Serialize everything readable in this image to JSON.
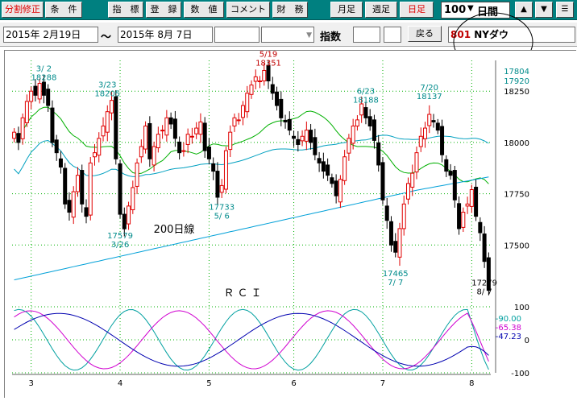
{
  "toolbar": {
    "buttons": [
      {
        "label": "分割修正",
        "color": "red"
      },
      {
        "label": "条　件"
      },
      {
        "label": "指　標"
      },
      {
        "label": "登　録"
      },
      {
        "label": "数　値"
      },
      {
        "label": "コメント"
      },
      {
        "label": "財　務"
      },
      {
        "label": "月足"
      },
      {
        "label": "週足"
      },
      {
        "label": "日足",
        "color": "red"
      }
    ],
    "period_value": "100",
    "period_unit": "日間",
    "up_icon": "triangle-up-icon",
    "down_icon": "triangle-down-icon",
    "menu_icon": "menu-icon"
  },
  "dates": {
    "start": "2015年 2月19日",
    "separator": "〜",
    "end": "2015年 8月 7日"
  },
  "index_label": "指数",
  "back_button": "戻る",
  "symbol": {
    "code": "801",
    "name": "NYダウ"
  },
  "colors": {
    "up_candle": "#e00000",
    "down_candle": "#000000",
    "ma_short": "#00b000",
    "ma_mid": "#00a0c0",
    "ma200": "#00a0d8",
    "rci_short": "#00a0a0",
    "rci_mid": "#d000d0",
    "rci_long": "#0000b0",
    "annotation_blue": "#008b8b",
    "annotation_red": "#c00000",
    "grid": "#00b000"
  },
  "chart_data": [
    {
      "type": "candlestick",
      "x_axis": "date (trading days)",
      "ylim": [
        17250,
        18400
      ],
      "price_ticks": [
        18250,
        18000,
        17750,
        17500
      ],
      "month_labels": [
        {
          "label": "3",
          "day": 4
        },
        {
          "label": "4",
          "day": 25
        },
        {
          "label": "5",
          "day": 46
        },
        {
          "label": "6",
          "day": 66
        },
        {
          "label": "7",
          "day": 87
        },
        {
          "label": "8",
          "day": 108
        }
      ],
      "ma_labels": {
        "top": "17804",
        "second": "17920"
      },
      "annotations": [
        {
          "text": [
            "3/ 2",
            "18288"
          ],
          "day": 7,
          "where": "above",
          "color": "blue"
        },
        {
          "text": [
            "3/23",
            "18205"
          ],
          "day": 22,
          "where": "above",
          "color": "blue"
        },
        {
          "text": [
            "17579",
            "3/26"
          ],
          "day": 25,
          "where": "below",
          "color": "blue"
        },
        {
          "text": [
            "5/19",
            "18351"
          ],
          "day": 60,
          "where": "above",
          "color": "red"
        },
        {
          "text": [
            "17733",
            "5/ 6"
          ],
          "day": 49,
          "where": "below",
          "color": "blue"
        },
        {
          "text": [
            "6/23",
            "18188"
          ],
          "day": 83,
          "where": "above",
          "color": "blue"
        },
        {
          "text": [
            "7/20",
            "18137"
          ],
          "day": 98,
          "where": "above",
          "color": "blue"
        },
        {
          "text": [
            "17465",
            "7/ 7"
          ],
          "day": 90,
          "where": "below",
          "color": "blue"
        },
        {
          "text": [
            "17279",
            "8/ 7"
          ],
          "day": 111,
          "where": "below",
          "color": "black"
        }
      ],
      "ma200_label": "200日線",
      "closes": [
        18050,
        18000,
        18120,
        18200,
        18250,
        18230,
        18288,
        18230,
        18180,
        18000,
        17950,
        17880,
        17700,
        17660,
        17760,
        17840,
        17700,
        17640,
        17900,
        17950,
        18020,
        18080,
        18150,
        18205,
        17920,
        17650,
        17579,
        17690,
        17780,
        17900,
        17980,
        18080,
        17920,
        17980,
        18040,
        18060,
        18120,
        18090,
        18020,
        17950,
        17960,
        18040,
        18030,
        18070,
        18100,
        17960,
        17920,
        17860,
        17733,
        17790,
        17960,
        18050,
        18120,
        18110,
        18180,
        18240,
        18280,
        18320,
        18300,
        18351,
        18300,
        18240,
        18180,
        18120,
        18100,
        18060,
        18020,
        17990,
        18030,
        18060,
        18000,
        17940,
        17900,
        17860,
        17840,
        17800,
        17740,
        17820,
        17930,
        18020,
        18080,
        18110,
        18188,
        18120,
        18080,
        18010,
        17890,
        17720,
        17620,
        17500,
        17465,
        17580,
        17700,
        17800,
        17850,
        17950,
        18030,
        18070,
        18137,
        18100,
        18060,
        17940,
        17860,
        17840,
        17720,
        17580,
        17660,
        17700,
        17770,
        17640,
        17560,
        17420,
        17279
      ],
      "ma_short": {
        "start": 17700,
        "end": 17750
      },
      "series_rci": [
        {
          "name": "-90.00",
          "final": -90.0,
          "color": "cyan"
        },
        {
          "name": "-65.38",
          "final": -65.38,
          "color": "magenta"
        },
        {
          "name": "-47.23",
          "final": -47.23,
          "color": "navy"
        }
      ]
    },
    {
      "type": "line",
      "title": "ＲＣＩ",
      "ylim": [
        -100,
        100
      ],
      "y_ticks": [
        100,
        0,
        -100
      ],
      "latest_values": [
        "-90.00",
        "-65.38",
        "-47.23"
      ]
    }
  ]
}
